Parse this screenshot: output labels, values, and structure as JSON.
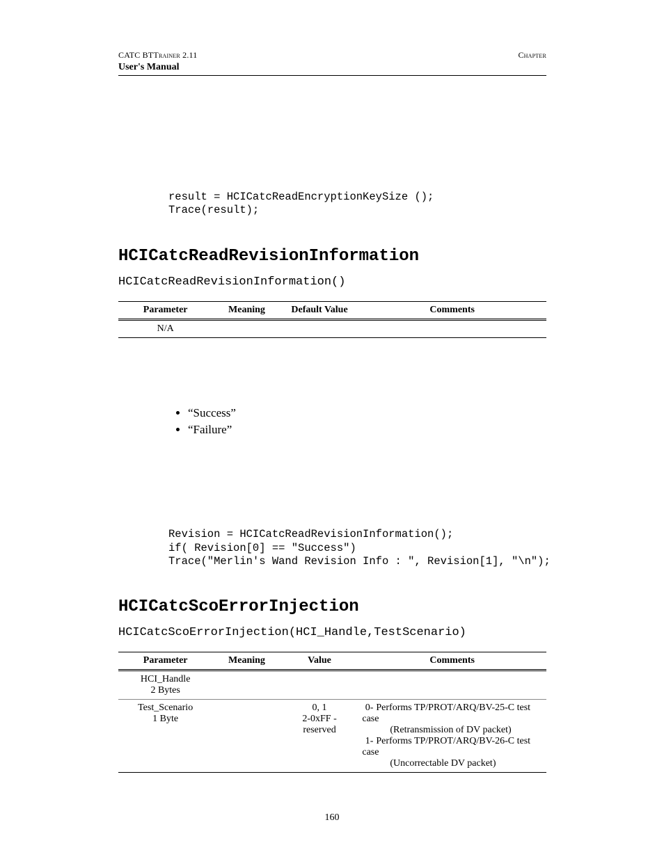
{
  "header": {
    "left_prefix": "CATC BT",
    "left_suffix": "Trainer",
    "left_version": " 2.11",
    "right": "Chapter",
    "manual": "User's Manual"
  },
  "code1": "result = HCICatcReadEncryptionKeySize ();\nTrace(result);",
  "section1": {
    "title": "HCICatcReadRevisionInformation",
    "signature": "HCICatcReadRevisionInformation()",
    "table": {
      "headers": [
        "Parameter",
        "Meaning",
        "Default Value",
        "Comments"
      ],
      "rows": [
        {
          "parameter": "N/A",
          "meaning": "",
          "value": "",
          "comments": ""
        }
      ]
    },
    "bullets": [
      "“Success”",
      "“Failure”"
    ],
    "code": "Revision = HCICatcReadRevisionInformation();\nif( Revision[0] == \"Success\")\nTrace(\"Merlin's Wand Revision Info : \", Revision[1], \"\\n\");"
  },
  "section2": {
    "title": "HCICatcScoErrorInjection",
    "signature": "HCICatcScoErrorInjection(HCI_Handle,TestScenario)",
    "table": {
      "headers": [
        "Parameter",
        "Meaning",
        "Value",
        "Comments"
      ],
      "rows": [
        {
          "parameter": "HCI_Handle",
          "parameter2": "2 Bytes",
          "meaning": "",
          "value": "",
          "comments": ""
        },
        {
          "parameter": "Test_Scenario",
          "parameter2": "1 Byte",
          "meaning": "",
          "value": "0, 1",
          "value2": "2-0xFF -",
          "value3": "reserved",
          "c_n0": "0-",
          "c_t0": "Performs TP/PROT/ARQ/BV-25-C test case",
          "c_t0b": "(Retransmission of DV packet)",
          "c_n1": "1-",
          "c_t1": "Performs TP/PROT/ARQ/BV-26-C test case",
          "c_t1b": "(Uncorrectable DV packet)"
        }
      ]
    }
  },
  "page_number": "160"
}
